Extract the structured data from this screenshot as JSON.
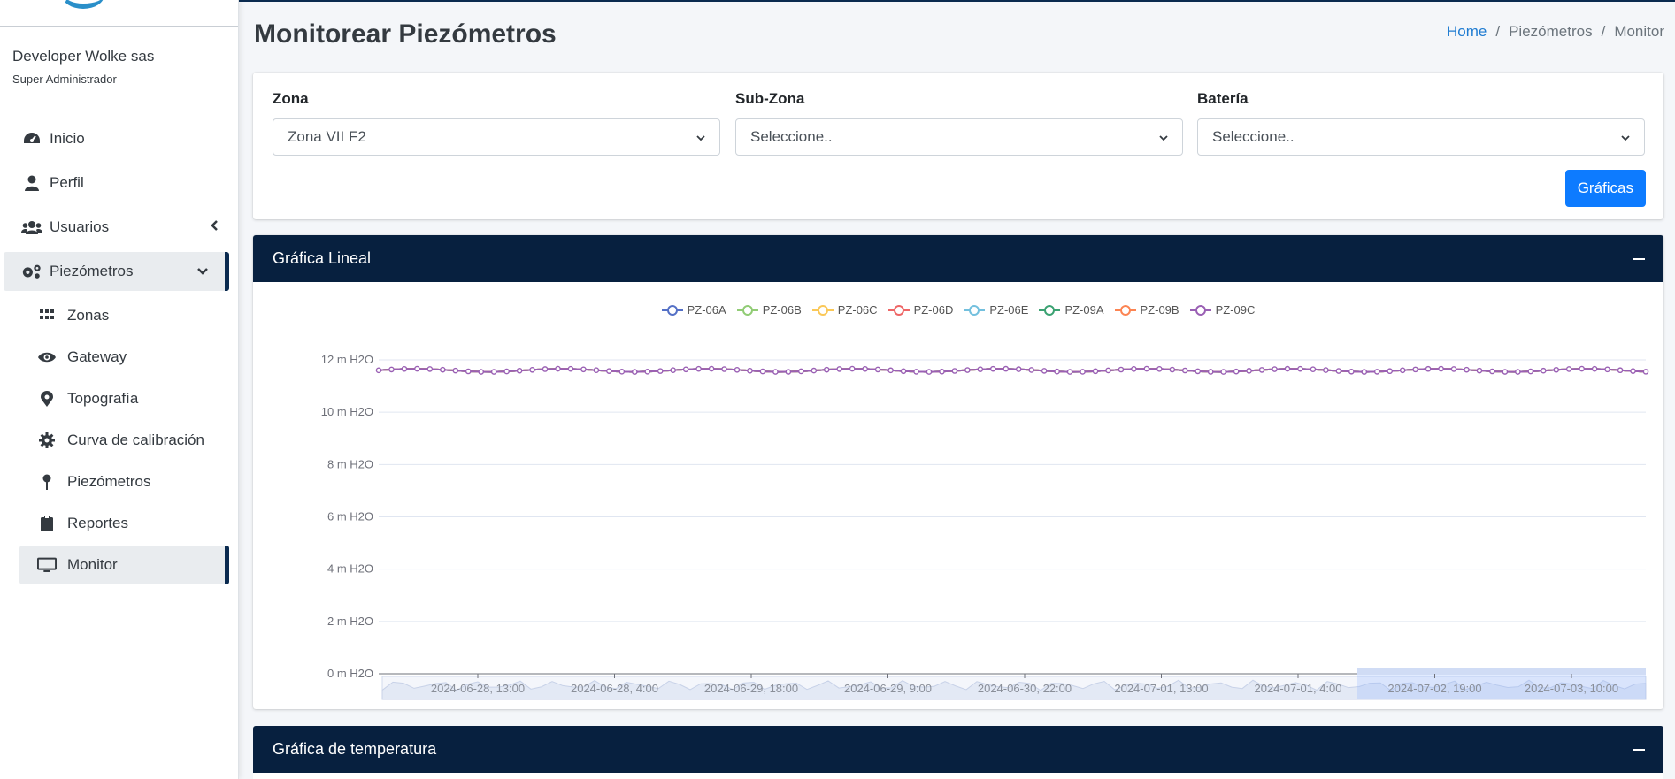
{
  "sidebar": {
    "user_name": "Developer Wolke sas",
    "user_role": "Super Administrador",
    "menu": [
      {
        "label": "Inicio",
        "icon": "dashboard-icon"
      },
      {
        "label": "Perfil",
        "icon": "user-icon"
      },
      {
        "label": "Usuarios",
        "icon": "users-icon"
      },
      {
        "label": "Piezómetros",
        "icon": "gears-icon"
      }
    ],
    "submenu": [
      {
        "label": "Zonas",
        "icon": "grid-icon"
      },
      {
        "label": "Gateway",
        "icon": "eye-icon"
      },
      {
        "label": "Topografía",
        "icon": "map-marker-icon"
      },
      {
        "label": "Curva de calibración",
        "icon": "gear-icon"
      },
      {
        "label": "Piezómetros",
        "icon": "pin-icon"
      },
      {
        "label": "Reportes",
        "icon": "clipboard-icon"
      },
      {
        "label": "Monitor",
        "icon": "desktop-icon"
      }
    ]
  },
  "header": {
    "title": "Monitorear Piezómetros",
    "breadcrumb": [
      "Home",
      "Piezómetros",
      "Monitor"
    ]
  },
  "filters": {
    "zona_label": "Zona",
    "zona_value": "Zona VII F2",
    "subzona_label": "Sub-Zona",
    "subzona_value": "Seleccione..",
    "bateria_label": "Batería",
    "bateria_value": "Seleccione..",
    "button_label": "Gráficas"
  },
  "cards": {
    "lineal_title": "Gráfica Lineal",
    "temperature_title": "Gráfica de temperatura"
  },
  "chart_data": {
    "type": "line",
    "title": "",
    "xlabel": "",
    "ylabel": "",
    "y_ticks": [
      "0 m H2O",
      "2 m H2O",
      "4 m H2O",
      "6 m H2O",
      "8 m H2O",
      "10 m H2O",
      "12 m H2O"
    ],
    "ylim": [
      0,
      12
    ],
    "x_ticks": [
      "2024-06-28, 13:00",
      "2024-06-28, 4:00",
      "2024-06-29, 18:00",
      "2024-06-29, 9:00",
      "2024-06-30, 22:00",
      "2024-07-01, 13:00",
      "2024-07-01, 4:00",
      "2024-07-02, 19:00",
      "2024-07-03, 10:00"
    ],
    "legend_position": "top-center",
    "grid": true,
    "series": [
      {
        "name": "PZ-06A",
        "color": "#5470c6",
        "value": 11.6
      },
      {
        "name": "PZ-06B",
        "color": "#91cc75",
        "value": 11.6
      },
      {
        "name": "PZ-06C",
        "color": "#fac858",
        "value": 11.6
      },
      {
        "name": "PZ-06D",
        "color": "#ee6666",
        "value": 11.6
      },
      {
        "name": "PZ-06E",
        "color": "#73c0de",
        "value": 11.6
      },
      {
        "name": "PZ-09A",
        "color": "#3ba272",
        "value": 11.6
      },
      {
        "name": "PZ-09B",
        "color": "#fc8452",
        "value": 11.6
      },
      {
        "name": "PZ-09C",
        "color": "#9a60b4",
        "value": 11.6
      }
    ],
    "visible_line_color": "#9a60b4",
    "point_count": 100
  },
  "colors": {
    "header_bg": "#07203f",
    "primary": "#0d7bff",
    "link": "#1e7bd1"
  }
}
